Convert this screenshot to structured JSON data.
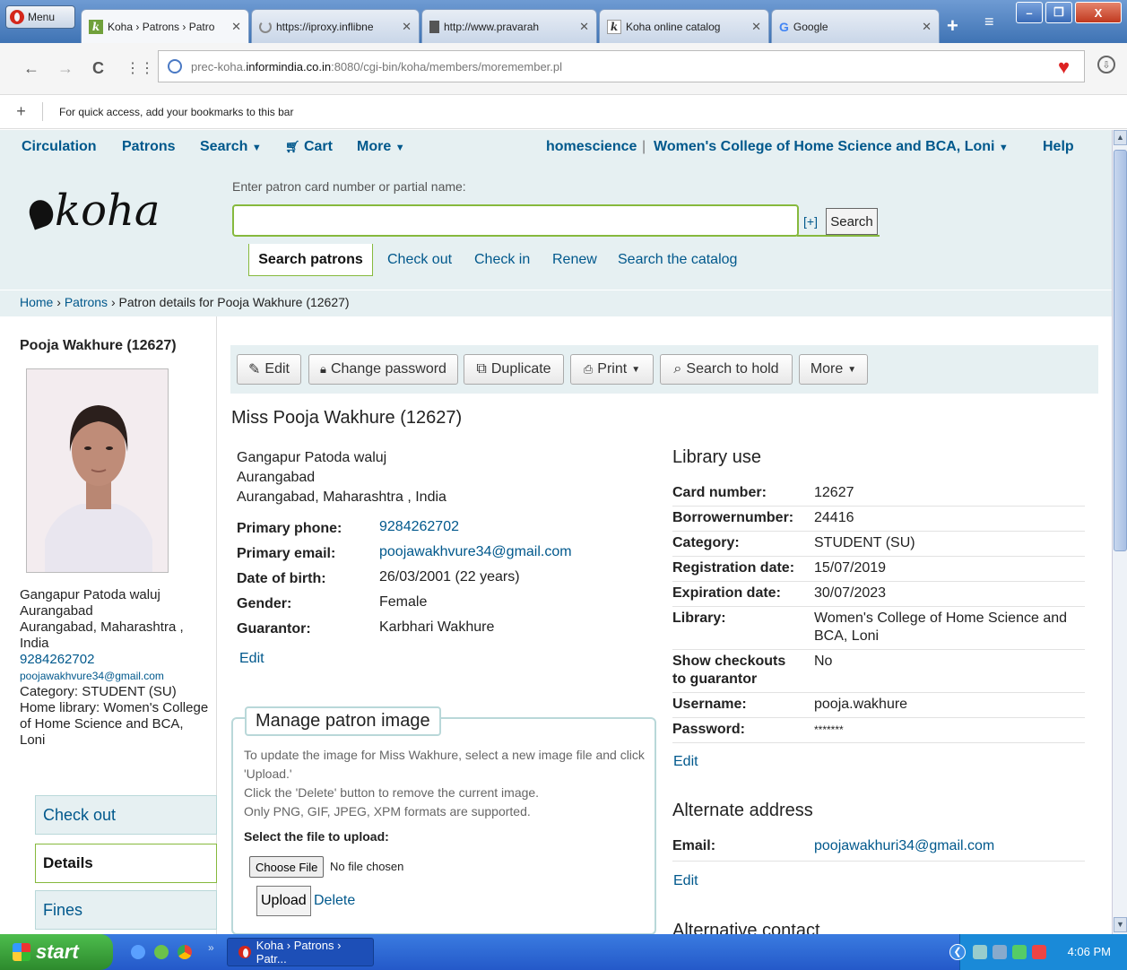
{
  "browser": {
    "menu_label": "Menu",
    "tabs": [
      {
        "label": "Koha › Patrons › Patro",
        "icon": "koha-icon"
      },
      {
        "label": "https://iproxy.inflibne",
        "icon": "loading-icon"
      },
      {
        "label": "http://www.pravarah",
        "icon": "document-icon"
      },
      {
        "label": "Koha online catalog",
        "icon": "koha-icon"
      },
      {
        "label": "Google",
        "icon": "google-icon"
      }
    ],
    "url_prefix": "prec-koha.",
    "url_domain": "informindia.co.in",
    "url_suffix": ":8080/cgi-bin/koha/members/moremember.pl",
    "bookmarks_hint": "For quick access, add your bookmarks to this bar"
  },
  "koha": {
    "nav": {
      "circulation": "Circulation",
      "patrons": "Patrons",
      "search": "Search",
      "cart": "Cart",
      "more": "More",
      "user": "homescience",
      "separator": "|",
      "library": "Women's College of Home Science and BCA, Loni",
      "help": "Help"
    },
    "logo_text": "koha",
    "search_prompt": "Enter patron card number or partial name:",
    "search_value": "",
    "advanced_toggle": "[+]",
    "search_button": "Search",
    "header_tabs": {
      "active": "Search patrons",
      "checkout": "Check out",
      "checkin": "Check in",
      "renew": "Renew",
      "catalog": "Search the catalog"
    },
    "breadcrumb": {
      "home": "Home",
      "sep": "›",
      "patrons": "Patrons",
      "current": "Patron details for Pooja Wakhure (12627)"
    }
  },
  "sidebar": {
    "patron_name": "Pooja Wakhure (12627)",
    "address1": "Gangapur Patoda waluj",
    "address2": "Aurangabad",
    "address3": "Aurangabad, Maharashtra ,",
    "address4": "India",
    "phone": "9284262702",
    "email": "poojawakhvure34@gmail.com",
    "category": "Category: STUDENT (SU)",
    "home_library": "Home library: Women's College of Home Science and BCA, Loni",
    "tabs": {
      "checkout": "Check out",
      "details": "Details",
      "fines": "Fines"
    }
  },
  "toolbar": {
    "edit": "Edit",
    "change_password": "Change password",
    "duplicate": "Duplicate",
    "print": "Print",
    "search_to_hold": "Search to hold",
    "more": "More"
  },
  "patron": {
    "heading": "Miss Pooja Wakhure (12627)",
    "address1": "Gangapur Patoda waluj",
    "address2": "Aurangabad",
    "address3": "Aurangabad, Maharashtra , India",
    "fields": [
      {
        "label": "Primary phone:",
        "value": "9284262702",
        "link": true
      },
      {
        "label": "Primary email:",
        "value": "poojawakhvure34@gmail.com",
        "link": true
      },
      {
        "label": "Date of birth:",
        "value": "26/03/2001 (22 years)",
        "link": false
      },
      {
        "label": "Gender:",
        "value": "Female",
        "link": false
      },
      {
        "label": "Guarantor:",
        "value": "Karbhari Wakhure",
        "link": false
      }
    ],
    "edit": "Edit"
  },
  "image_box": {
    "title": "Manage patron image",
    "desc1": "To update the image for Miss Wakhure, select a new image file and click 'Upload.'",
    "desc2": "Click the 'Delete' button to remove the current image.",
    "desc3": "Only PNG, GIF, JPEG, XPM formats are supported.",
    "select_label": "Select the file to upload:",
    "choose_button": "Choose File",
    "no_file": "No file chosen",
    "upload_button": "Upload",
    "delete_link": "Delete"
  },
  "library_use": {
    "heading": "Library use",
    "fields": [
      {
        "label": "Card number:",
        "value": "12627"
      },
      {
        "label": "Borrowernumber:",
        "value": "24416"
      },
      {
        "label": "Category:",
        "value": "STUDENT (SU)"
      },
      {
        "label": "Registration date:",
        "value": "15/07/2019"
      },
      {
        "label": "Expiration date:",
        "value": "30/07/2023"
      },
      {
        "label": "Library:",
        "value": "Women's College of Home Science and BCA, Loni"
      },
      {
        "label": "Show checkouts to guarantor",
        "value": "No"
      },
      {
        "label": "Username:",
        "value": "pooja.wakhure"
      },
      {
        "label": "Password:",
        "value": "*******"
      }
    ],
    "edit": "Edit"
  },
  "alternate_address": {
    "heading": "Alternate address",
    "email_label": "Email:",
    "email_value": "poojawakhuri34@gmail.com",
    "edit": "Edit"
  },
  "alternative_contact": {
    "heading": "Alternative contact"
  },
  "taskbar": {
    "start": "start",
    "task": "Koha › Patrons › Patr...",
    "clock": "4:06 PM"
  }
}
